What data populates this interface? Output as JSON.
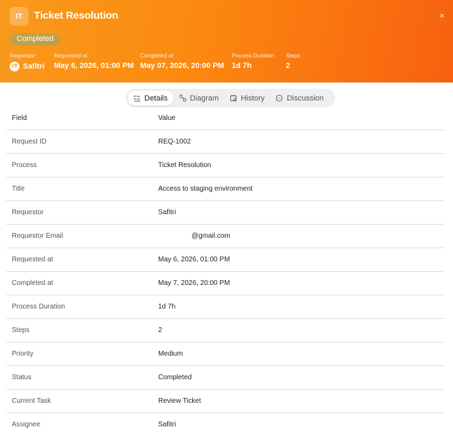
{
  "header": {
    "badge": "IT",
    "title": "Ticket Resolution",
    "status": "Completed",
    "meta": [
      {
        "label": "Requestor",
        "value": "Safitri",
        "avatar": "CR"
      },
      {
        "label": "Requested at",
        "value": "May 6, 2026, 01:00 PM"
      },
      {
        "label": "Completed at",
        "value": "May 07, 2026, 20:00 PM"
      },
      {
        "label": "Process Duration",
        "value": "1d 7h"
      },
      {
        "label": "Steps",
        "value": "2"
      }
    ],
    "close_icon": "×"
  },
  "tabs": [
    {
      "label": "Details",
      "icon": "list-check-icon",
      "active": true
    },
    {
      "label": "Diagram",
      "icon": "diagram-icon",
      "active": false
    },
    {
      "label": "History",
      "icon": "history-icon",
      "active": false
    },
    {
      "label": "Discussion",
      "icon": "chat-icon",
      "active": false
    }
  ],
  "table": {
    "headers": [
      "Field",
      "Value"
    ],
    "rows": [
      [
        "Request ID",
        "REQ-1002"
      ],
      [
        "Process",
        "Ticket Resolution"
      ],
      [
        "Title",
        "Access to staging environment"
      ],
      [
        "Requestor",
        "Safitri"
      ],
      [
        "Requestor Email",
        "@gmail.com"
      ],
      [
        "Requested at",
        "May 6, 2026, 01:00 PM"
      ],
      [
        "Completed at",
        "May 7, 2026, 20:00 PM"
      ],
      [
        "Process Duration",
        "1d 7h"
      ],
      [
        "Steps",
        "2"
      ],
      [
        "Priority",
        "Medium"
      ],
      [
        "Status",
        "Completed"
      ],
      [
        "Current Task",
        "Review Ticket"
      ],
      [
        "Assignee",
        "Safitri"
      ]
    ]
  },
  "colors": {
    "header_start": "#f99a1c",
    "header_end": "#f8600f",
    "status_pill": "#b5a156"
  }
}
